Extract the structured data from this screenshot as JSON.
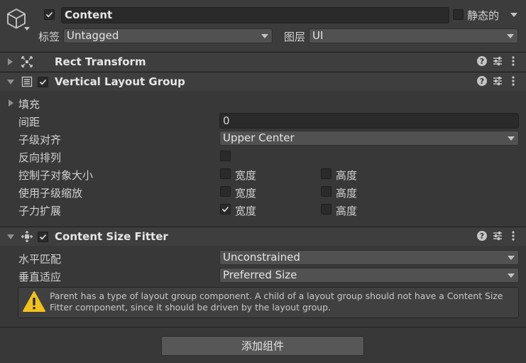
{
  "gameobject": {
    "name": "Content",
    "active": true,
    "static_label": "静态的",
    "tag_label": "标签",
    "tag_value": "Untagged",
    "layer_label": "图层",
    "layer_value": "UI"
  },
  "components": {
    "rect_transform": {
      "title": "Rect Transform"
    },
    "vertical_layout": {
      "title": "Vertical Layout Group",
      "enabled": true,
      "padding_label": "填充",
      "spacing_label": "间距",
      "spacing_value": "0",
      "child_alignment_label": "子级对齐",
      "child_alignment_value": "Upper Center",
      "reverse_label": "反向排列",
      "control_size_label": "控制子对象大小",
      "use_scale_label": "使用子级缩放",
      "force_expand_label": "子力扩展",
      "width_label": "宽度",
      "height_label": "高度",
      "control_width": false,
      "control_height": false,
      "scale_width": false,
      "scale_height": false,
      "expand_width": true,
      "expand_height": false,
      "reverse": false
    },
    "content_size_fitter": {
      "title": "Content Size Fitter",
      "enabled": true,
      "horizontal_label": "水平匹配",
      "horizontal_value": "Unconstrained",
      "vertical_label": "垂直适应",
      "vertical_value": "Preferred Size",
      "warning": "Parent has a type of layout group component. A child of a layout group should not have a Content Size Fitter component, since it should be driven by the layout group."
    }
  },
  "add_component_label": "添加组件",
  "icons": [
    "cube-icon",
    "help-icon",
    "preset-icon",
    "menu-dots-icon",
    "rect-transform-icon",
    "vertical-layout-icon",
    "content-size-fitter-icon",
    "warning-icon"
  ]
}
